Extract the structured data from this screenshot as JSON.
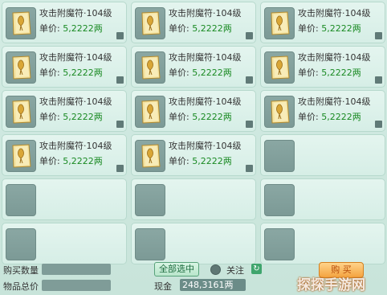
{
  "items": [
    {
      "name": "攻击附魔符·104级",
      "price_label": "单价:",
      "price": "5,2222两",
      "filled": true
    },
    {
      "name": "攻击附魔符·104级",
      "price_label": "单价:",
      "price": "5,2222两",
      "filled": true
    },
    {
      "name": "攻击附魔符·104级",
      "price_label": "单价:",
      "price": "5,2222两",
      "filled": true
    },
    {
      "name": "攻击附魔符·104级",
      "price_label": "单价:",
      "price": "5,2222两",
      "filled": true
    },
    {
      "name": "攻击附魔符·104级",
      "price_label": "单价:",
      "price": "5,2222两",
      "filled": true
    },
    {
      "name": "攻击附魔符·104级",
      "price_label": "单价:",
      "price": "5,2222两",
      "filled": true
    },
    {
      "name": "攻击附魔符·104级",
      "price_label": "单价:",
      "price": "5,2222两",
      "filled": true
    },
    {
      "name": "攻击附魔符·104级",
      "price_label": "单价:",
      "price": "5,2222两",
      "filled": true
    },
    {
      "name": "攻击附魔符·104级",
      "price_label": "单价:",
      "price": "5,2222两",
      "filled": true
    },
    {
      "name": "攻击附魔符·104级",
      "price_label": "单价:",
      "price": "5,2222两",
      "filled": true
    },
    {
      "name": "攻击附魔符·104级",
      "price_label": "单价:",
      "price": "5,2222两",
      "filled": true
    },
    {
      "filled": false
    },
    {
      "filled": false
    },
    {
      "filled": false
    },
    {
      "filled": false
    },
    {
      "filled": false
    },
    {
      "filled": false
    },
    {
      "filled": false
    }
  ],
  "footer": {
    "buy_quantity_label": "购买数量",
    "total_price_label": "物品总价",
    "select_all_label": "全部选中",
    "follow_label": "关注",
    "money_label": "现金",
    "money_value": "248,3161两",
    "buy_label": "购 买"
  },
  "watermark": "探探手游网",
  "colors": {
    "price_green": "#1a8a23",
    "cell_bg": "#e4f5ef",
    "slot_bg": "#8aa7a3",
    "buy_button": "#f4a33f"
  },
  "icons": {
    "item": "enchant-scroll-icon",
    "follow": "radio-icon",
    "refresh": "refresh-icon"
  }
}
